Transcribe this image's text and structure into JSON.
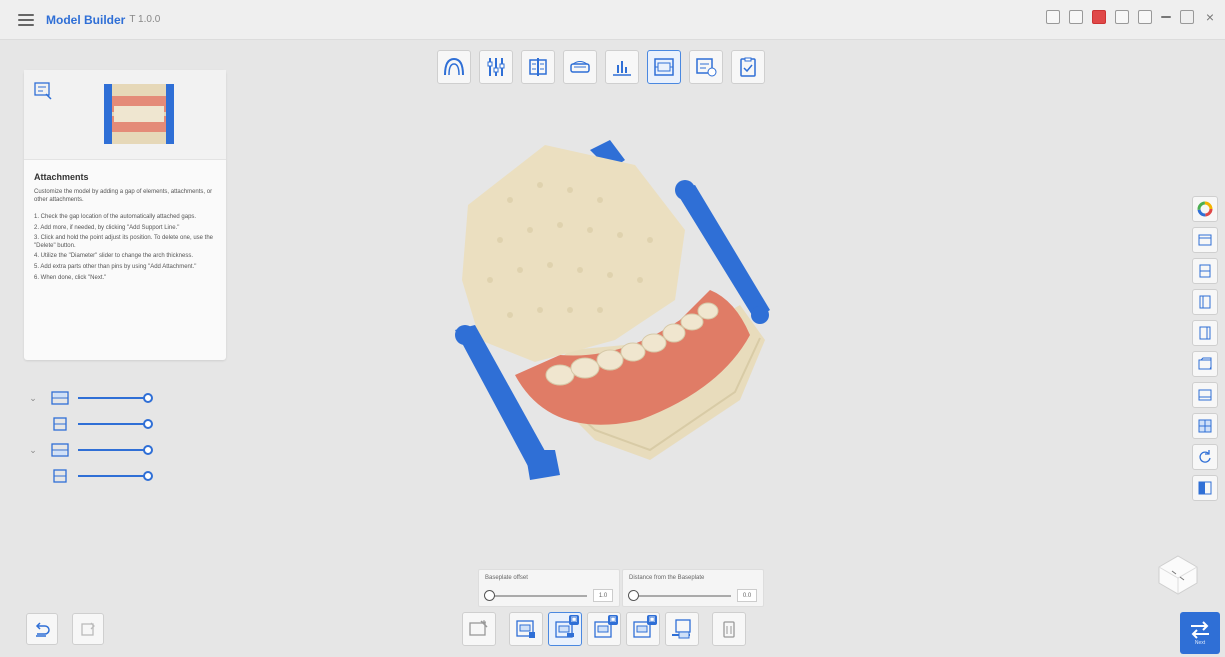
{
  "app": {
    "title": "Model Builder",
    "version": "T 1.0.0"
  },
  "guide": {
    "title": "Attachments",
    "description": "Customize the model by adding a gap of elements, attachments, or other attachments.",
    "steps": [
      "1. Check the gap location of the automatically attached gaps.",
      "2. Add more, if needed, by clicking \"Add Support Line.\"",
      "3. Click and hold the point adjust its position. To delete one, use the \"Delete\" button.",
      "4. Utilize the \"Diameter\" slider to change the arch thickness.",
      "5. Add extra parts other than pins by using \"Add Attachment.\"",
      "6. When done, click \"Next.\""
    ]
  },
  "params": {
    "thickness_label": "Baseplate offset",
    "thickness_value": "1.0",
    "distance_label": "Distance from the Baseplate",
    "distance_value": "0.0"
  },
  "next_label": "Next"
}
